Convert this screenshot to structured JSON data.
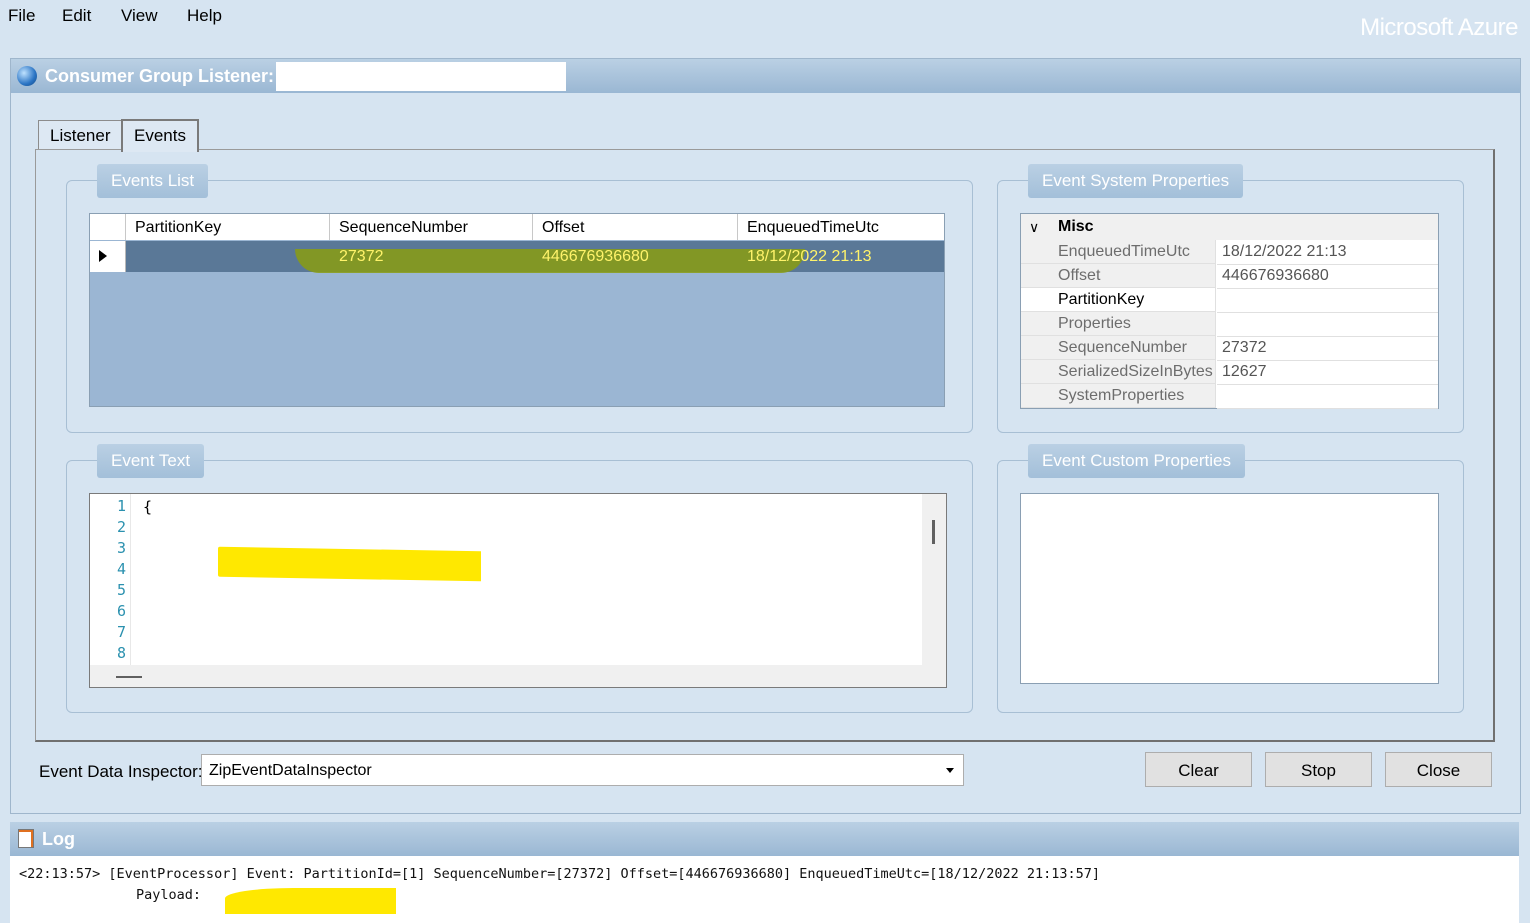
{
  "menu": {
    "items": [
      "File",
      "Edit",
      "View",
      "Help"
    ]
  },
  "brand": "Microsoft Azure",
  "consumer_group": {
    "title": "Consumer Group Listener:",
    "value": ""
  },
  "tabs": [
    {
      "label": "Listener"
    },
    {
      "label": "Events"
    }
  ],
  "events_list": {
    "label": "Events List",
    "columns": [
      "PartitionKey",
      "SequenceNumber",
      "Offset",
      "EnqueuedTimeUtc"
    ],
    "rows": [
      {
        "partition_key": "",
        "sequence_number": "27372",
        "offset": "446676936680",
        "enqueued": "18/12/2022 21:13"
      }
    ]
  },
  "system_properties": {
    "label": "Event System Properties",
    "category": "Misc",
    "rows": [
      {
        "name": "EnqueuedTimeUtc",
        "value": "18/12/2022 21:13"
      },
      {
        "name": "Offset",
        "value": "446676936680"
      },
      {
        "name": "PartitionKey",
        "value": ""
      },
      {
        "name": "Properties",
        "value": ""
      },
      {
        "name": "SequenceNumber",
        "value": "27372"
      },
      {
        "name": "SerializedSizeInBytes",
        "value": "12627"
      },
      {
        "name": "SystemProperties",
        "value": ""
      }
    ]
  },
  "event_text": {
    "label": "Event Text",
    "line_numbers": [
      "1",
      "2",
      "3",
      "4",
      "5",
      "6",
      "7",
      "8"
    ],
    "first_line": "{"
  },
  "custom_properties": {
    "label": "Event Custom Properties"
  },
  "inspector": {
    "label": "Event Data Inspector:",
    "value": "ZipEventDataInspector"
  },
  "buttons": {
    "clear": "Clear",
    "stop": "Stop",
    "close": "Close"
  },
  "log": {
    "title": "Log",
    "line1": "<22:13:57> [EventProcessor] Event: PartitionId=[1] SequenceNumber=[27372] Offset=[446676936680] EnqueuedTimeUtc=[18/12/2022 21:13:57]",
    "line2": "Payload:"
  },
  "colors": {
    "highlight": "#ffe800",
    "selected_row": "#5a7897",
    "grid_background": "#9bb6d3"
  }
}
